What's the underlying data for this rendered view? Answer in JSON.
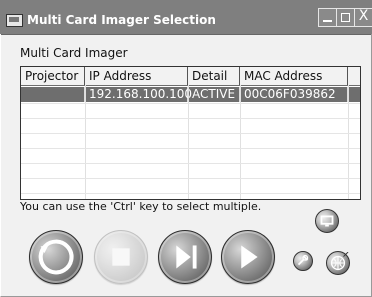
{
  "window": {
    "title": "Multi Card Imager Selection",
    "minimize_label": "",
    "maximize_label": "",
    "close_label": "X"
  },
  "panel": {
    "label": "Multi Card Imager"
  },
  "table": {
    "columns": [
      "Projector",
      "IP Address",
      "Detail",
      "MAC Address"
    ],
    "rows": [
      {
        "projector": "",
        "ip": "192.168.100.100",
        "detail": "ACTIVE",
        "mac": "00C06F039862"
      }
    ]
  },
  "hint": {
    "text": "You can use the 'Ctrl' key to select multiple."
  },
  "controls": {
    "refresh_icon": "refresh-icon",
    "stop_icon": "stop-icon",
    "step_icon": "step-forward-icon",
    "play_icon": "play-icon",
    "monitor_icon": "monitor-icon",
    "settings_icon": "wrench-icon",
    "help_icon": "globe-icon"
  },
  "colors": {
    "titlebar": "#7f7f7f",
    "selected_row": "#6e6e6e",
    "accent": "#4b4b4b"
  }
}
